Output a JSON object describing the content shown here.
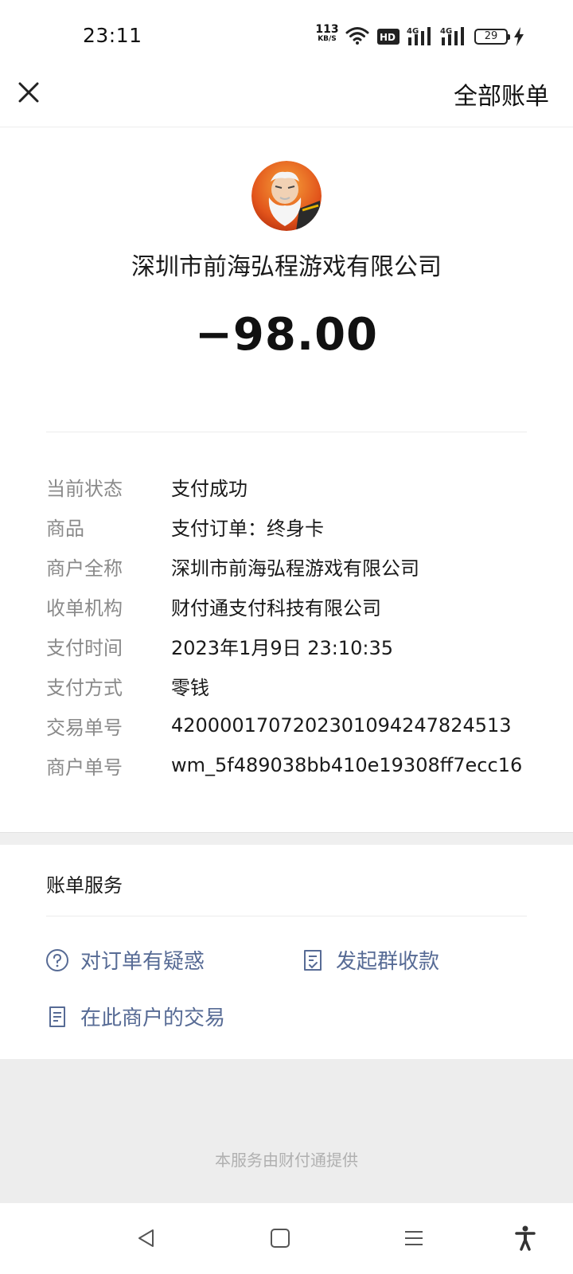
{
  "status_bar": {
    "time": "23:11",
    "net_speed": "113",
    "net_speed_unit": "KB/S",
    "hd_label": "HD",
    "sim1_label": "4G",
    "sim2_label": "4G",
    "battery": "29",
    "icons": [
      "wifi-icon",
      "hd-icon",
      "signal-icon",
      "signal-icon",
      "battery-icon",
      "charging-icon"
    ]
  },
  "header": {
    "close_icon": "close-icon",
    "all_bills_label": "全部账单"
  },
  "merchant": {
    "name": "深圳市前海弘程游戏有限公司",
    "amount": "−98.00"
  },
  "details": [
    {
      "label": "当前状态",
      "value": "支付成功"
    },
    {
      "label": "商品",
      "value": "支付订单：终身卡"
    },
    {
      "label": "商户全称",
      "value": "深圳市前海弘程游戏有限公司"
    },
    {
      "label": "收单机构",
      "value": "财付通支付科技有限公司"
    },
    {
      "label": "支付时间",
      "value": "2023年1月9日 23:10:35"
    },
    {
      "label": "支付方式",
      "value": "零钱"
    },
    {
      "label": "交易单号",
      "value": "4200001707202301094247824513"
    },
    {
      "label": "商户单号",
      "value": "wm_5f489038bb410e19308ff7ecc16"
    }
  ],
  "service": {
    "title": "账单服务",
    "doubt_label": "对订单有疑惑",
    "group_label": "发起群收款",
    "merchant_tx_label": "在此商户的交易"
  },
  "footer": {
    "text": "本服务由财付通提供"
  },
  "colors": {
    "link": "#576b95",
    "label_gray": "#8a8a8a",
    "band_gray": "#ededed"
  }
}
